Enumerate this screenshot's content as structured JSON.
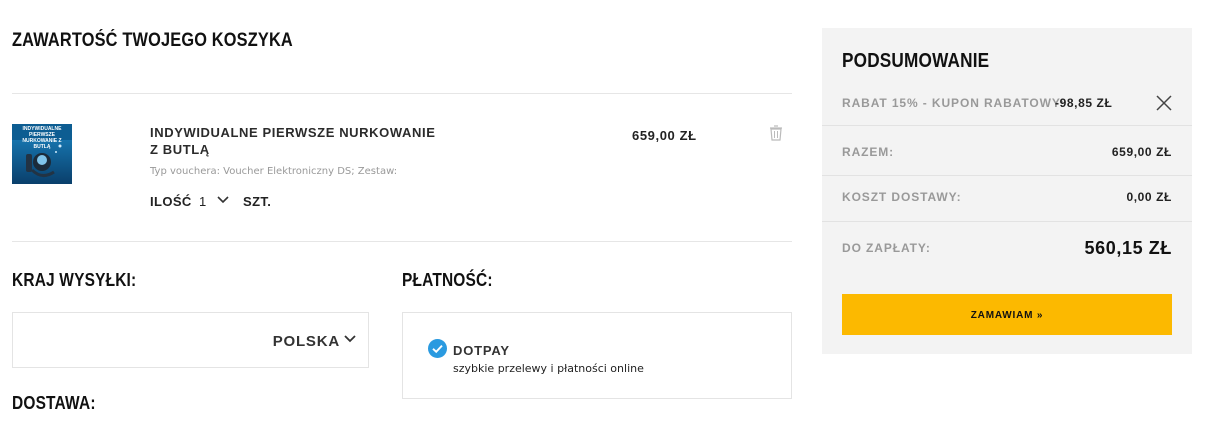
{
  "cart": {
    "title": "ZAWARTOŚĆ TWOJEGO KOSZYKA",
    "item": {
      "thumb_caption": "INDYWIDUALNE PIERWSZE NURKOWANIE Z BUTLĄ",
      "name": "INDYWIDUALNE PIERWSZE NURKOWANIE Z BUTLĄ",
      "meta": "Typ vouchera: Voucher Elektroniczny DS; Zestaw:",
      "qty_label": "ILOŚĆ",
      "qty_value": "1",
      "qty_unit": "SZT.",
      "price": "659,00 ZŁ",
      "delete_icon": "trash-icon"
    }
  },
  "shipping": {
    "country_title": "KRAJ WYSYŁKI:",
    "country_value": "POLSKA",
    "delivery_title": "DOSTAWA:"
  },
  "payment": {
    "title": "PŁATNOŚĆ:",
    "method_name": "DOTPAY",
    "method_desc": "szybkie przelewy i płatności online",
    "selected": true,
    "check_color": "#2a9ae0"
  },
  "summary": {
    "title": "PODSUMOWANIE",
    "discount_label": "RABAT 15% - KUPON RABATOWY:",
    "discount_value": "-98,85 ZŁ",
    "subtotal_label": "RAZEM:",
    "subtotal_value": "659,00 ZŁ",
    "shipping_label": "KOSZT DOSTAWY:",
    "shipping_value": "0,00 ZŁ",
    "total_label": "DO ZAPŁATY:",
    "total_value": "560,15 ZŁ",
    "order_button": "ZAMAWIAM »",
    "button_color": "#fcb900"
  }
}
